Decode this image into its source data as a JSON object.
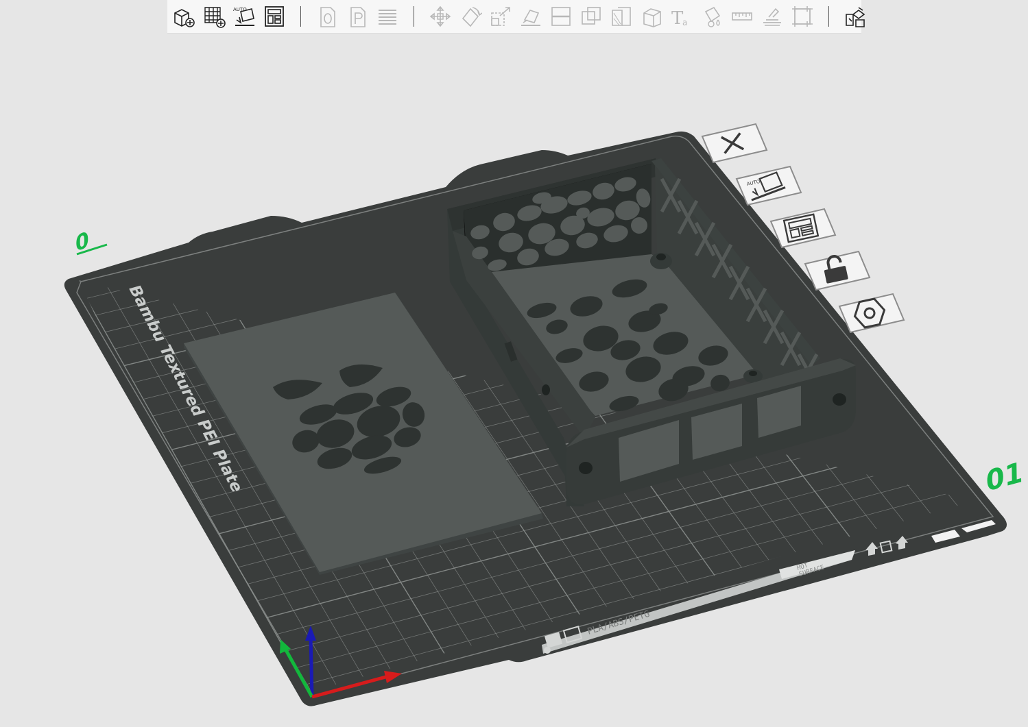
{
  "toolbar": {
    "groups": [
      [
        {
          "name": "add-object-icon",
          "enabled": true
        },
        {
          "name": "add-plate-icon",
          "enabled": true
        },
        {
          "name": "auto-orient-icon",
          "enabled": true,
          "text": "AUTO"
        },
        {
          "name": "arrange-icon",
          "enabled": true
        }
      ],
      [
        {
          "name": "split-to-objects-icon",
          "enabled": false
        },
        {
          "name": "split-to-parts-icon",
          "enabled": false
        },
        {
          "name": "layers-icon",
          "enabled": false
        }
      ],
      [
        {
          "name": "move-icon",
          "enabled": false
        },
        {
          "name": "rotate-icon",
          "enabled": false
        },
        {
          "name": "scale-icon",
          "enabled": false
        },
        {
          "name": "lay-on-face-icon",
          "enabled": false
        },
        {
          "name": "cut-icon",
          "enabled": false
        },
        {
          "name": "boolean-icon",
          "enabled": false
        },
        {
          "name": "support-paint-icon",
          "enabled": false
        },
        {
          "name": "seam-paint-icon",
          "enabled": false
        },
        {
          "name": "text-icon",
          "enabled": false,
          "text": "Ta"
        },
        {
          "name": "color-paint-icon",
          "enabled": false
        },
        {
          "name": "measure-icon",
          "enabled": false
        },
        {
          "name": "emboss-icon",
          "enabled": false
        },
        {
          "name": "assembly-icon",
          "enabled": false
        }
      ],
      [
        {
          "name": "assembly-view-icon",
          "enabled": true
        }
      ]
    ]
  },
  "plate": {
    "name": "Bambu Textured PEI Plate",
    "materials": "PLA/ABS/PETG",
    "hot_warning_line1": "HOT",
    "hot_warning_line2": "SURFACE",
    "plate_number": "01",
    "origin_label": "0",
    "colors": {
      "plate": "#3a3d3c",
      "grid": "#8a8e8c",
      "label_green": "#18b84a",
      "model_dark": "#2e3331",
      "model_mid": "#434846",
      "model_light": "#555a58"
    }
  },
  "plate_controls": [
    {
      "name": "delete-plate-icon"
    },
    {
      "name": "auto-orient-plate-icon",
      "text": "AUTO"
    },
    {
      "name": "arrange-plate-icon"
    },
    {
      "name": "lock-plate-icon"
    },
    {
      "name": "plate-settings-icon"
    }
  ],
  "axes": {
    "x_color": "#d61c1c",
    "y_color": "#12b83c",
    "z_color": "#1a1ab4"
  }
}
